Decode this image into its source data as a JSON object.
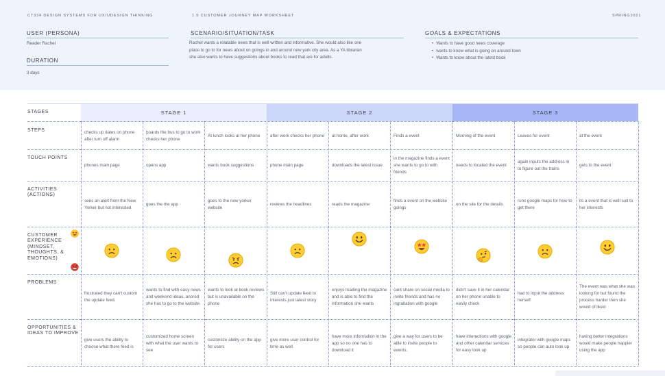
{
  "header": {
    "course": "CT334 DESIGN SYSTEMS FOR UX/UI",
    "topic": "DESIGN THINKING",
    "worksheet": "1.0 CUSTOMER JOURNEY MAP WORKSHEET",
    "term": "SPRING2021"
  },
  "persona": {
    "title": "USER (PERSONA)",
    "value": "Reader Rachel"
  },
  "duration": {
    "title": "DURATION",
    "value": "3 days"
  },
  "scenario": {
    "title": "SCENARIO/SITUATION/TASK",
    "lines": [
      "Rachel wants a relatable news that is well written and informative. She would also like one",
      "place to go to for news about on goings in and around new york city area. As a YA librarian",
      "she also wants to have suggestions about books to read that are for adults."
    ]
  },
  "goals": {
    "title": "GOALS & EXPECTATIONS",
    "items": [
      "Wants to have good news coverage",
      "wants to know what is going on around town",
      "Wants to know about the latest book"
    ]
  },
  "stages_label": "STAGES",
  "stages": [
    "STAGE 1",
    "STAGE 2",
    "STAGE 3"
  ],
  "stage_colors": [
    "#e9eefc",
    "#ccd6fb",
    "#a6b6f7"
  ],
  "rows": {
    "steps": {
      "label": "STEPS",
      "cells": [
        "checks up dates on phone after turn off alarm",
        "boards the bus to go to work checks her phone",
        "At lunch looks at her phone",
        "after work checks her phone",
        "at home, after work",
        "Finds a event",
        "Morning of the event",
        "Leaves for event",
        "at the event"
      ]
    },
    "touch": {
      "label": "TOUCH POINTS",
      "cells": [
        "phones main page",
        "opens app",
        "wants book suggestions",
        "phone main page",
        "downloads the latest issue",
        "in the magazine finds a event she wants to go to with friends",
        "needs to located the event",
        "again inputs the address in to figure out the trains",
        "gets to the event"
      ]
    },
    "activities": {
      "label": "ACTIVITIES (ACTIONS)",
      "cells": [
        "sees an alert from the New Yorker but not interested",
        "goes the the app",
        "goes to the new yorker website",
        "reviews the headlines",
        "reads the magazine",
        "finds a event on the website goings",
        "on the site for the details",
        "runs google maps for how to get there",
        "its a event that is well suit to her interests"
      ]
    },
    "experience": {
      "label": "CUSTOMER EXPERIENCE (MINDSET, THOUGHTS, & EMOTIONS)",
      "emotions": [
        "frown",
        "frown",
        "angry",
        "frown",
        "smile",
        "star-eyes",
        "thinking",
        "frown",
        "smile"
      ]
    },
    "problems": {
      "label": "PROBLEMS",
      "cells": [
        "frustrated they can't custom the update feed.",
        "wants to find with easy news and weekend ideas, anored she has to go to the website",
        "wants to look at book reviews but is unavailable on the phone",
        "Still can't update feed to interests just latest story",
        "enjoys reading the magazine and is able to find the information she wants",
        "cant share on social media to invite friends and has no ingratiation with google",
        "didn't save it in her calendar on her phone unable to easily check",
        "had to input the address herself",
        "The event was what she was looking for but found the process harder then she would of liked"
      ]
    },
    "opportunities": {
      "label": "OPPORTUNITIES & IDEAS TO IMPROVE",
      "cells": [
        "give users the ability to choose what there feed is",
        "customized home screen with what the user wants to see",
        "customize ability on the app for users",
        "give more user control for time as well.",
        "have more information in the app so no one has to download it",
        "give a way for users to be able to invite people to events.",
        "have interactions with google and other calendar services for easy look up",
        "integrator with google maps so people can auto look up",
        "having better integrations would make people happier using the app"
      ]
    }
  }
}
